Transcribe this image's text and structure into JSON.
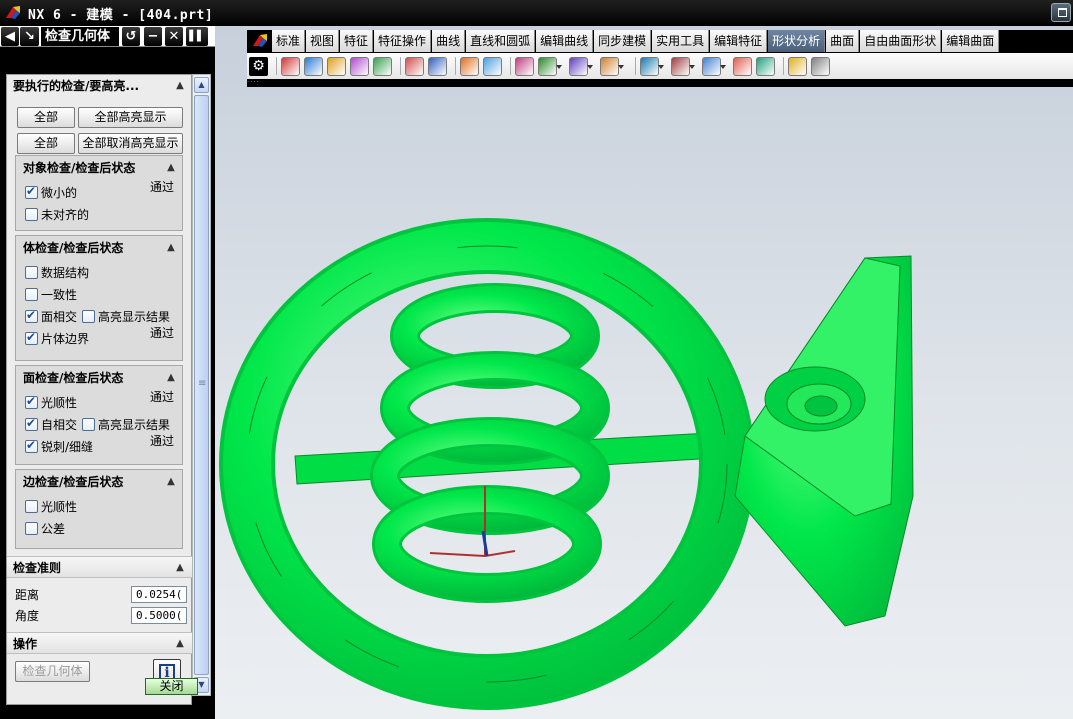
{
  "window": {
    "title": "NX 6 - 建模 - [404.prt]"
  },
  "panel": {
    "title": "检查几何体",
    "main_group_title": "要执行的检查/要高亮...",
    "all_label_1": "全部",
    "highlight_all_label": "全部高亮显示",
    "all_label_2": "全部",
    "unhighlight_all_label": "全部取消高亮显示",
    "groups": [
      {
        "title": "对象检查/检查后状态",
        "items": [
          {
            "label": "微小的",
            "checked": true,
            "status": "通过"
          },
          {
            "label": "未对齐的",
            "checked": false,
            "status": ""
          }
        ]
      },
      {
        "title": "体检查/检查后状态",
        "items": [
          {
            "label": "数据结构",
            "checked": false,
            "status": ""
          },
          {
            "label": "一致性",
            "checked": false,
            "status": ""
          },
          {
            "label": "面相交",
            "checked": true,
            "status": "",
            "extra_label": "高亮显示结果"
          },
          {
            "label": "片体边界",
            "checked": true,
            "status": "通过"
          }
        ]
      },
      {
        "title": "面检查/检查后状态",
        "items": [
          {
            "label": "光顺性",
            "checked": true,
            "status": "通过"
          },
          {
            "label": "自相交",
            "checked": true,
            "status": "",
            "extra_label": "高亮显示结果"
          },
          {
            "label": "锐刺/细缝",
            "checked": true,
            "status": "通过"
          }
        ]
      },
      {
        "title": "边检查/检查后状态",
        "items": [
          {
            "label": "光顺性",
            "checked": false,
            "status": ""
          },
          {
            "label": "公差",
            "checked": false,
            "status": ""
          }
        ]
      }
    ],
    "criteria": {
      "title": "检查准则",
      "distance_label": "距离",
      "distance_value": "0.0254(",
      "angle_label": "角度",
      "angle_value": "0.5000("
    },
    "operation": {
      "title": "操作",
      "check_button": "检查几何体"
    },
    "close_button": "关闭"
  },
  "ribbon": {
    "tabs": [
      "标准",
      "视图",
      "特征",
      "特征操作",
      "曲线",
      "直线和圆弧",
      "编辑曲线",
      "同步建模",
      "实用工具",
      "编辑特征",
      "形状分析",
      "曲面",
      "自由曲面形状",
      "编辑曲面"
    ],
    "active_tab": "形状分析",
    "tools": [
      "gear-icon",
      "shape-analysis-1-icon",
      "shape-analysis-2-icon",
      "shape-analysis-3-icon",
      "shape-analysis-4-icon",
      "shape-analysis-5-icon",
      "deviation-icon",
      "curve-analysis-icon",
      "face-analysis-icon",
      "point-analysis-icon",
      "curvature-comb-icon",
      "section-analysis-icon",
      "highlight-lines-icon",
      "reflection-icon",
      "slope-icon",
      "distance-icon",
      "radius-icon",
      "draft-icon",
      "surface-continuity-icon",
      "check-geometry-icon",
      "analysis-options-icon"
    ]
  },
  "colors": {
    "model_green": "#00e84a",
    "model_edge": "#0a8a2a",
    "active_tab": "#5a7090",
    "close_button": "#a5d995"
  }
}
